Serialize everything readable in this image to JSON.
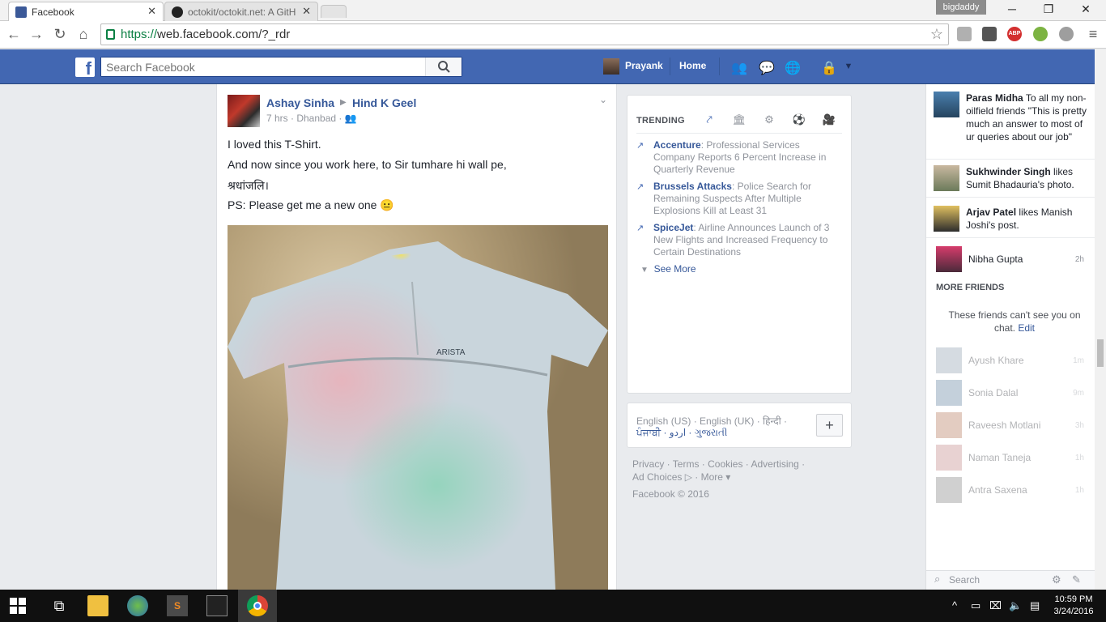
{
  "browser": {
    "tabs": [
      {
        "label": "Facebook",
        "active": true
      },
      {
        "label": "octokit/octokit.net: A GitH",
        "active": false
      }
    ],
    "profile": "bigdaddy",
    "url_protocol": "https://",
    "url_rest": "web.facebook.com/?_rdr"
  },
  "fb_header": {
    "search_placeholder": "Search Facebook",
    "user_name": "Prayank",
    "home_label": "Home"
  },
  "post": {
    "author": "Ashay Sinha",
    "target": "Hind K Geel",
    "meta": "7 hrs · Dhanbad ·",
    "lines": [
      "I loved this T-Shirt.",
      "And now since you work here, to Sir tumhare hi wall pe,",
      "श्रधांजलि।",
      "PS: Please get me a new one 😐"
    ],
    "shirt_brand": "ARISTA"
  },
  "trending": {
    "title": "TRENDING",
    "items": [
      {
        "topic": "Accenture",
        "text": ": Professional Services Company Reports 6 Percent Increase in Quarterly Revenue"
      },
      {
        "topic": "Brussels Attacks",
        "text": ": Police Search for Remaining Suspects After Multiple Explosions Kill at Least 31"
      },
      {
        "topic": "SpiceJet",
        "text": ": Airline Announces Launch of 3 New Flights and Increased Frequency to Certain Destinations"
      }
    ],
    "see_more": "See More"
  },
  "languages": {
    "line1": "English (US) · English (UK) · हिन्दी ·",
    "line2": "ਪੰਜਾਬੀ · اردو · ગુજરાતી",
    "plus": "+"
  },
  "footer": {
    "line1": "Privacy · Terms · Cookies · Advertising ·",
    "line2": "Ad Choices ▷ · More ▾",
    "line3": "Facebook © 2016"
  },
  "chat": {
    "tickers": [
      {
        "name": "Paras Midha",
        "text": " To all my non-oilfield friends \"This is pretty much an answer to most of ur queries about our job\""
      },
      {
        "name": "Sukhwinder Singh",
        "text": " likes Sumit Bhadauria's photo."
      },
      {
        "name": "Arjav Patel",
        "text": " likes Manish Joshi's post."
      }
    ],
    "online": [
      {
        "name": "Nibha Gupta",
        "time": "2h"
      }
    ],
    "more_friends_label": "MORE FRIENDS",
    "cant_see_text": "These friends can't see you on chat.",
    "edit_label": "Edit",
    "offline": [
      {
        "name": "Ayush Khare",
        "time": "1m"
      },
      {
        "name": "Sonia Dalal",
        "time": "9m"
      },
      {
        "name": "Raveesh Motlani",
        "time": "3h"
      },
      {
        "name": "Naman Taneja",
        "time": "1h"
      },
      {
        "name": "Antra Saxena",
        "time": "1h"
      }
    ],
    "search_placeholder": "Search"
  },
  "taskbar": {
    "time": "10:59 PM",
    "date": "3/24/2016"
  },
  "colors": {
    "fb_blue": "#4267b2",
    "link": "#365899"
  }
}
